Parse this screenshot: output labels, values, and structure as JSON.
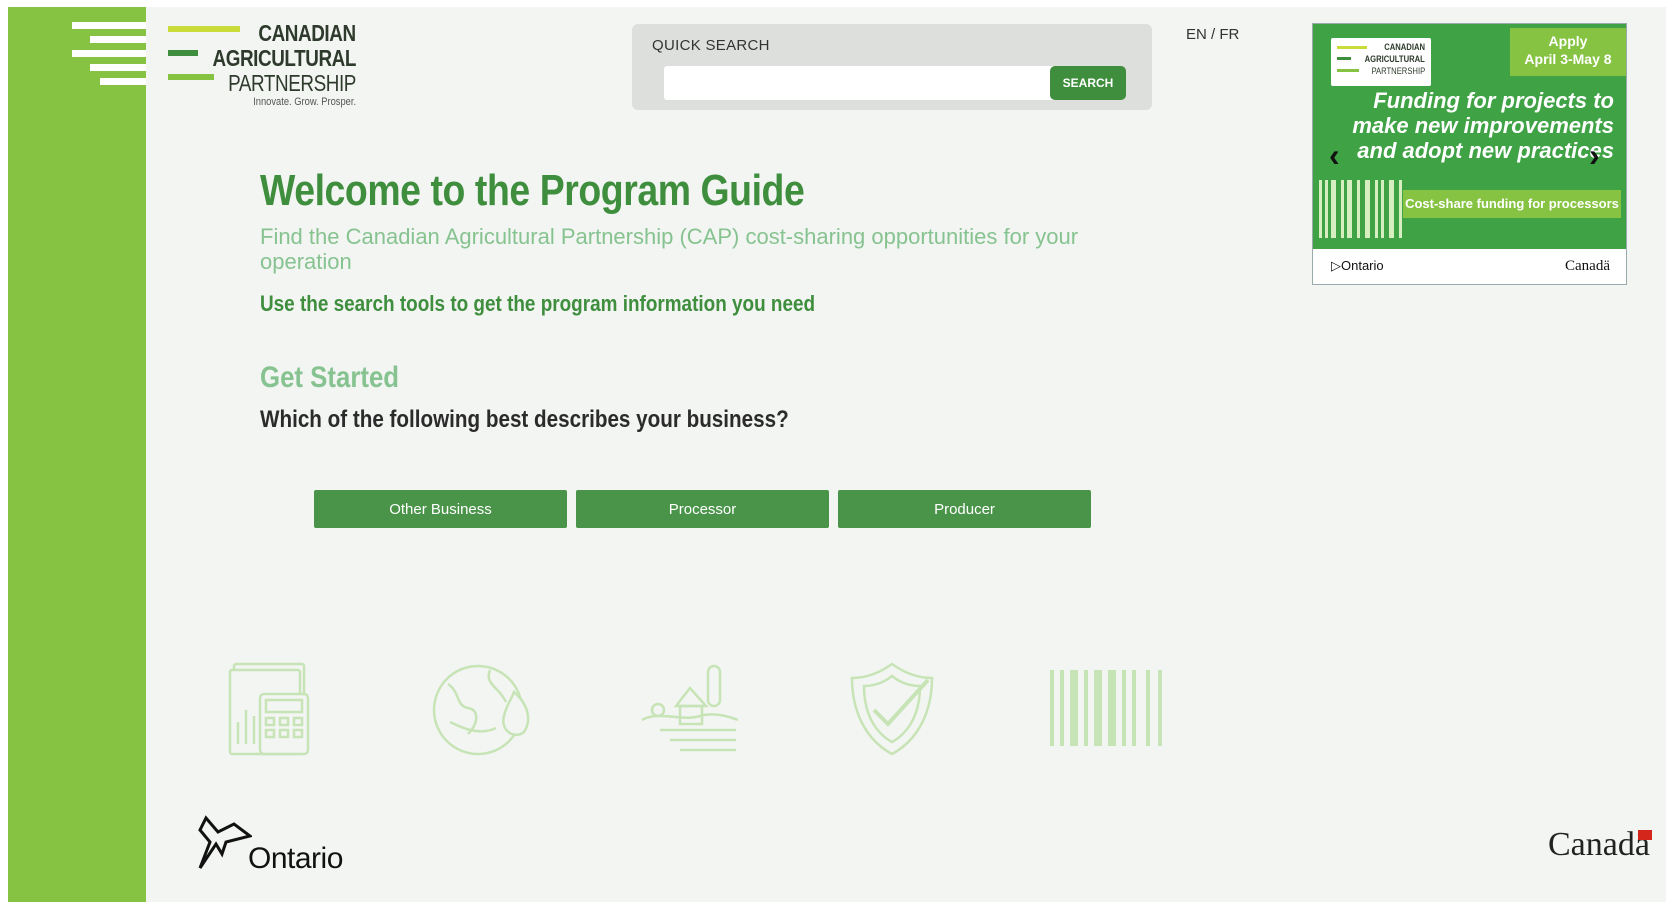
{
  "brand": {
    "line1": "CANADIAN",
    "line2": "AGRICULTURAL",
    "line3": "PARTNERSHIP",
    "tagline": "Innovate. Grow. Prosper."
  },
  "menu": {
    "icon": "hamburger-menu-icon"
  },
  "search": {
    "label": "QUICK SEARCH",
    "placeholder": "",
    "value": "",
    "button_label": "SEARCH"
  },
  "lang": {
    "label": "EN / FR"
  },
  "banner": {
    "logo_line1": "CANADIAN",
    "logo_line2": "AGRICULTURAL",
    "logo_line3": "PARTNERSHIP",
    "apply_line1": "Apply",
    "apply_line2": "April 3-May 8",
    "headline_1": "Funding for projects to",
    "headline_2": "make new improvements",
    "headline_3": "and adopt new practices",
    "cost_share": "Cost-share funding for processors",
    "ontario": "Ontario",
    "canada": "Canadä",
    "prev_icon": "chevron-left-icon",
    "next_icon": "chevron-right-icon"
  },
  "main": {
    "title": "Welcome to the Program Guide",
    "subtitle": "Find the Canadian Agricultural Partnership (CAP) cost-sharing opportunities for your operation",
    "instruction": "Use the search tools to get the program information you need",
    "get_started": "Get Started",
    "question": "Which of the following best describes your business?",
    "buttons": [
      "Other Business",
      "Processor",
      "Producer"
    ]
  },
  "decorative_icons": [
    "calculator-document-icon",
    "globe-leaf-icon",
    "farm-barn-icon",
    "shield-check-icon",
    "barcode-icon"
  ],
  "footer": {
    "ontario": "Ontario",
    "canada": "Canadä"
  },
  "colors": {
    "side_bar": "#86c342",
    "primary_green": "#3e8e3e",
    "light_green": "#86c390",
    "button_green": "#4a944a",
    "page_bg": "#f3f5f2"
  }
}
